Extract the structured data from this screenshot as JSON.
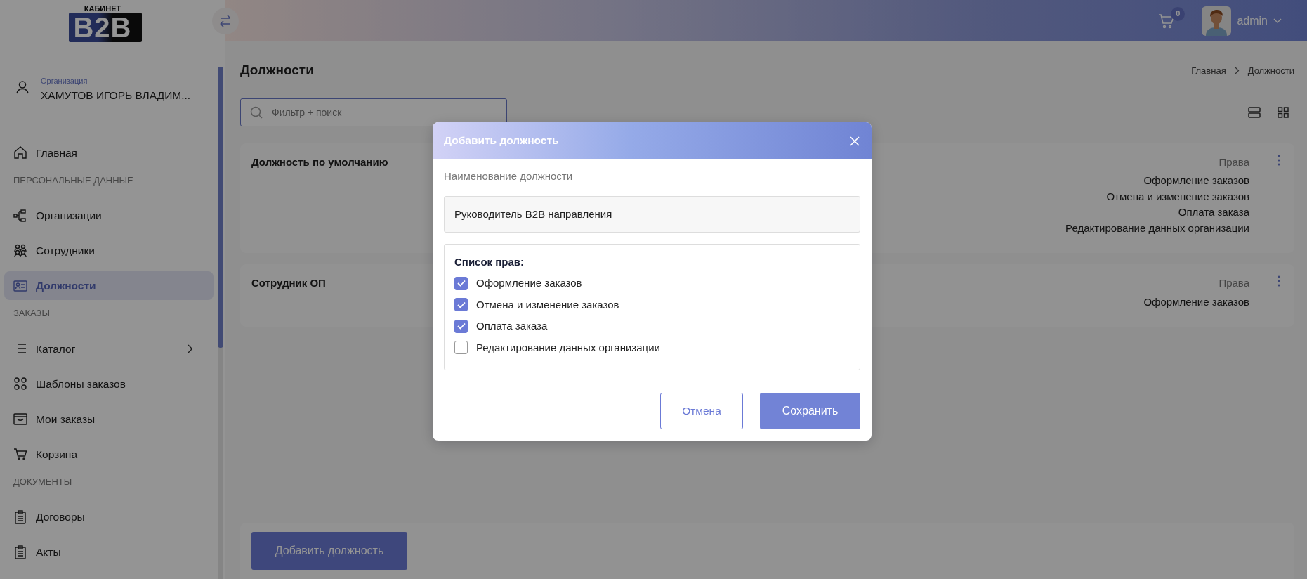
{
  "logo": {
    "caption": "КАБИНЕТ",
    "mark": "B2B"
  },
  "header": {
    "cart_count": "0",
    "user": "admin"
  },
  "sidebar": {
    "organization": {
      "label": "Организация",
      "name": "ХАМУТОВ ИГОРЬ ВЛАДИМ..."
    },
    "items": [
      {
        "kind": "item",
        "label": "Главная",
        "selected": false,
        "expandable": false
      },
      {
        "kind": "section",
        "label": "ПЕРСОНАЛЬНЫЕ ДАННЫЕ"
      },
      {
        "kind": "item",
        "label": "Организации",
        "selected": false,
        "expandable": false
      },
      {
        "kind": "item",
        "label": "Сотрудники",
        "selected": false,
        "expandable": false
      },
      {
        "kind": "item",
        "label": "Должности",
        "selected": true,
        "expandable": false
      },
      {
        "kind": "section",
        "label": "ЗАКАЗЫ"
      },
      {
        "kind": "item",
        "label": "Каталог",
        "selected": false,
        "expandable": true
      },
      {
        "kind": "item",
        "label": "Шаблоны заказов",
        "selected": false,
        "expandable": false
      },
      {
        "kind": "item",
        "label": "Мои заказы",
        "selected": false,
        "expandable": false
      },
      {
        "kind": "item",
        "label": "Корзина",
        "selected": false,
        "expandable": false
      },
      {
        "kind": "section",
        "label": "ДОКУМЕНТЫ"
      },
      {
        "kind": "item",
        "label": "Договоры",
        "selected": false,
        "expandable": false
      },
      {
        "kind": "item",
        "label": "Акты",
        "selected": false,
        "expandable": false
      }
    ]
  },
  "page": {
    "title": "Должности",
    "breadcrumb": [
      "Главная",
      "Должности"
    ],
    "search": {
      "placeholder": "Фильтр + поиск"
    },
    "positions": [
      {
        "name": "Должность по умолчанию",
        "rights_label": "Права",
        "rights": [
          "Оформление заказов",
          "Отмена и изменение заказов",
          "Оплата заказа",
          "Редактирование данных организации"
        ]
      },
      {
        "name": "Сотрудник ОП",
        "rights_label": "Права",
        "rights": [
          "Оформление заказов"
        ]
      }
    ],
    "add_button": "Добавить должность"
  },
  "modal": {
    "title": "Добавить должность",
    "field_label": "Наименование должности",
    "field_value": "Руководитель B2B направления",
    "rights_title": "Список прав:",
    "rights": [
      {
        "label": "Оформление заказов",
        "checked": true
      },
      {
        "label": "Отмена и изменение заказов",
        "checked": true
      },
      {
        "label": "Оплата заказа",
        "checked": true
      },
      {
        "label": "Редактирование данных организации",
        "checked": false
      }
    ],
    "cancel": "Отмена",
    "save": "Сохранить"
  }
}
